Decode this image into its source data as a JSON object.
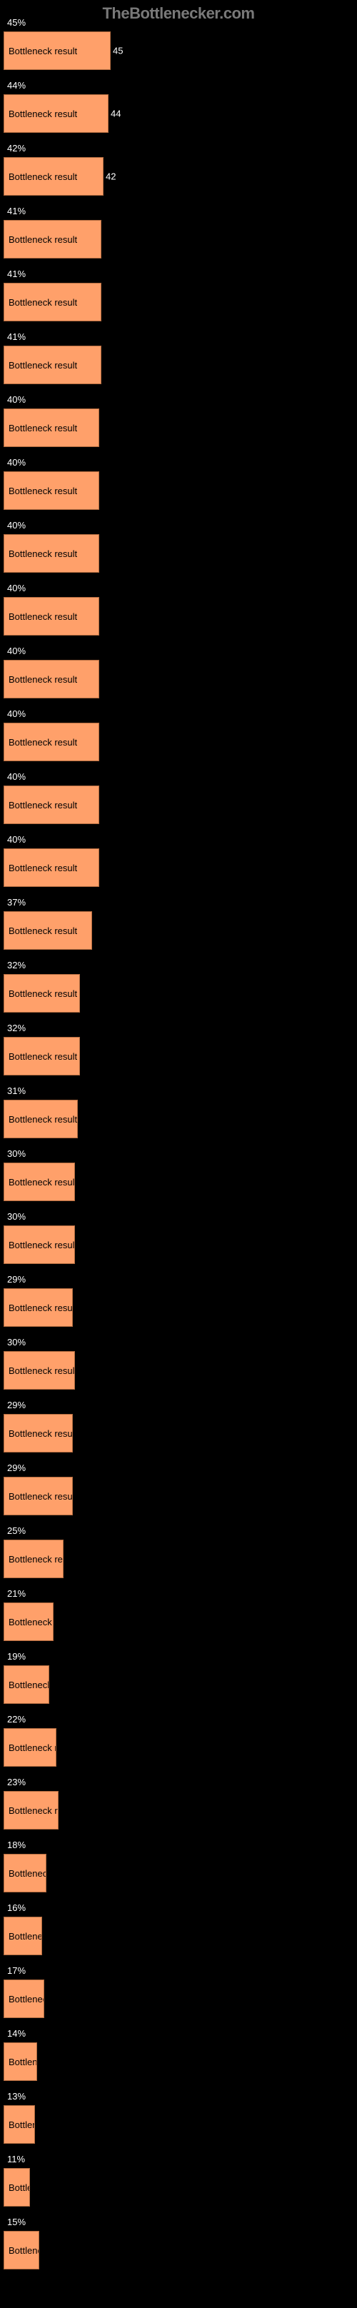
{
  "header": "TheBottlenecker.com",
  "bar_label": "Bottleneck result",
  "chart_data": {
    "type": "bar",
    "title": "",
    "xlabel": "",
    "ylabel": "",
    "categories": [],
    "series": [
      {
        "name": "Bottleneck result",
        "values": [
          45,
          44,
          42,
          41,
          41,
          41,
          40,
          40,
          40,
          40,
          40,
          40,
          40,
          40,
          37,
          32,
          32,
          31,
          30,
          30,
          29,
          30,
          29,
          29,
          25,
          21,
          19,
          22,
          23,
          18,
          16,
          17,
          14,
          13,
          11,
          15
        ]
      }
    ],
    "xlim": [
      0,
      150
    ]
  },
  "bars": [
    {
      "pct": 45,
      "width": 150,
      "show_value_right": true
    },
    {
      "pct": 44,
      "width": 147,
      "show_value_right": true
    },
    {
      "pct": 42,
      "width": 140,
      "show_value_right": true
    },
    {
      "pct": 41,
      "width": 137,
      "show_value_right": false
    },
    {
      "pct": 41,
      "width": 137,
      "show_value_right": false
    },
    {
      "pct": 41,
      "width": 137,
      "show_value_right": false
    },
    {
      "pct": 40,
      "width": 134,
      "show_value_right": false
    },
    {
      "pct": 40,
      "width": 134,
      "show_value_right": false
    },
    {
      "pct": 40,
      "width": 134,
      "show_value_right": false
    },
    {
      "pct": 40,
      "width": 134,
      "show_value_right": false
    },
    {
      "pct": 40,
      "width": 134,
      "show_value_right": false
    },
    {
      "pct": 40,
      "width": 134,
      "show_value_right": false
    },
    {
      "pct": 40,
      "width": 134,
      "show_value_right": false
    },
    {
      "pct": 40,
      "width": 134,
      "show_value_right": false
    },
    {
      "pct": 37,
      "width": 124,
      "show_value_right": false
    },
    {
      "pct": 32,
      "width": 107,
      "show_value_right": false
    },
    {
      "pct": 32,
      "width": 107,
      "show_value_right": false
    },
    {
      "pct": 31,
      "width": 104,
      "show_value_right": false
    },
    {
      "pct": 30,
      "width": 100,
      "show_value_right": false
    },
    {
      "pct": 30,
      "width": 100,
      "show_value_right": false
    },
    {
      "pct": 29,
      "width": 97,
      "show_value_right": false
    },
    {
      "pct": 30,
      "width": 100,
      "show_value_right": false
    },
    {
      "pct": 29,
      "width": 97,
      "show_value_right": false
    },
    {
      "pct": 29,
      "width": 97,
      "show_value_right": false
    },
    {
      "pct": 25,
      "width": 84,
      "show_value_right": false
    },
    {
      "pct": 21,
      "width": 70,
      "show_value_right": false
    },
    {
      "pct": 19,
      "width": 64,
      "show_value_right": false
    },
    {
      "pct": 22,
      "width": 74,
      "show_value_right": false
    },
    {
      "pct": 23,
      "width": 77,
      "show_value_right": false
    },
    {
      "pct": 18,
      "width": 60,
      "show_value_right": false
    },
    {
      "pct": 16,
      "width": 54,
      "show_value_right": false
    },
    {
      "pct": 17,
      "width": 57,
      "show_value_right": false
    },
    {
      "pct": 14,
      "width": 47,
      "show_value_right": false
    },
    {
      "pct": 13,
      "width": 44,
      "show_value_right": false
    },
    {
      "pct": 11,
      "width": 37,
      "show_value_right": false
    },
    {
      "pct": 15,
      "width": 50,
      "show_value_right": false
    }
  ]
}
